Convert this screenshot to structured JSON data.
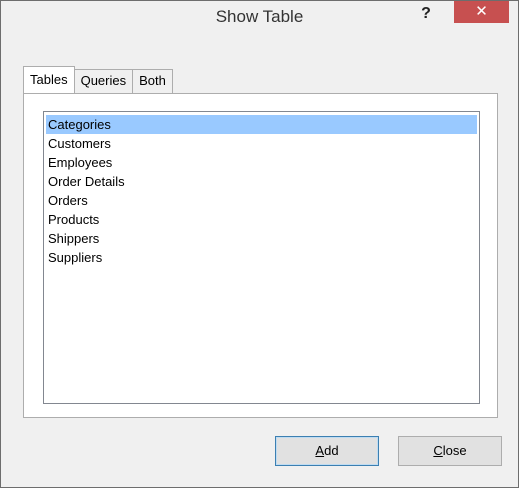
{
  "window": {
    "title": "Show Table",
    "help_label": "?",
    "close_label": "✕"
  },
  "tabs": [
    {
      "label": "Tables",
      "active": true
    },
    {
      "label": "Queries",
      "active": false
    },
    {
      "label": "Both",
      "active": false
    }
  ],
  "list": {
    "items": [
      "Categories",
      "Customers",
      "Employees",
      "Order Details",
      "Orders",
      "Products",
      "Shippers",
      "Suppliers"
    ],
    "selected_index": 0
  },
  "buttons": {
    "add": {
      "accel": "A",
      "rest": "dd"
    },
    "close": {
      "accel": "C",
      "rest": "lose"
    }
  },
  "colors": {
    "selection": "#99c9ff",
    "close_button": "#c75050",
    "default_button_border": "#3c7fb1"
  }
}
